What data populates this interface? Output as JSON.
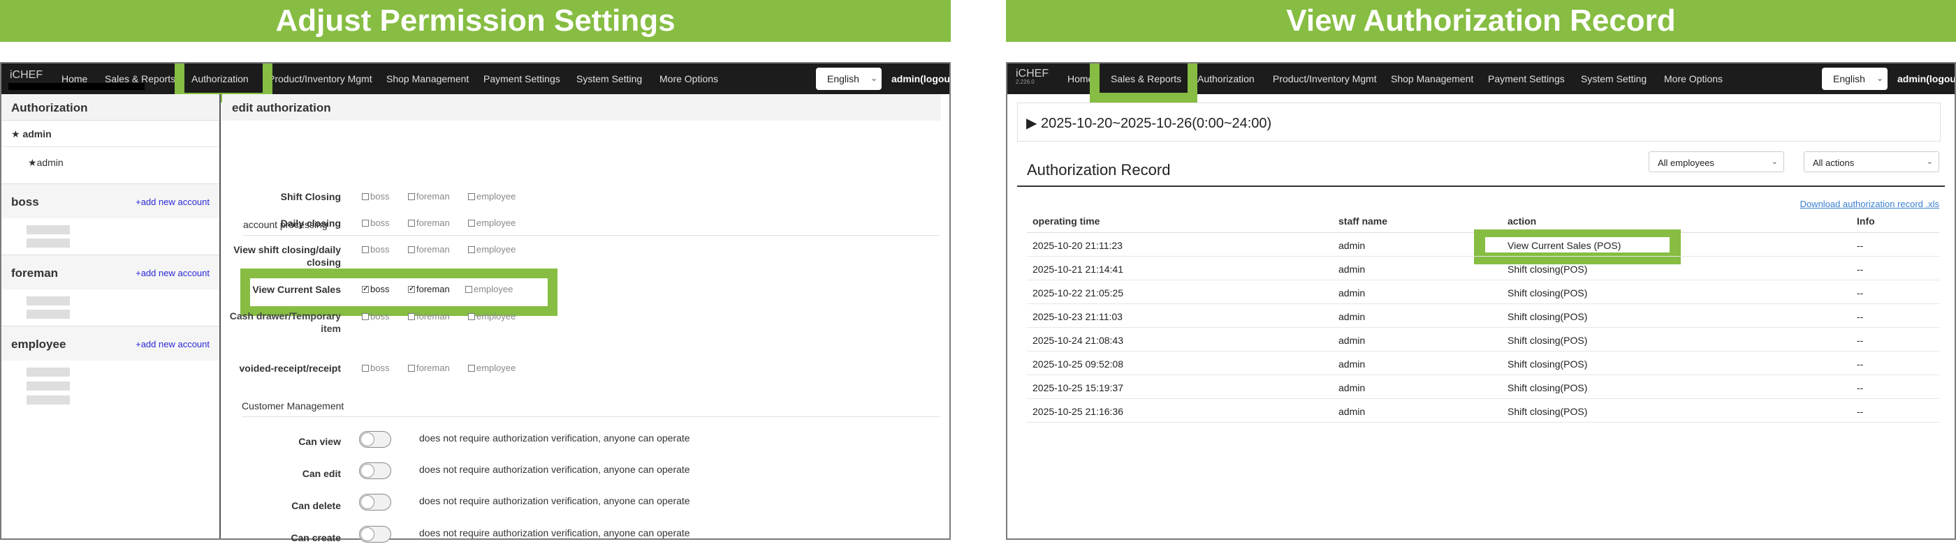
{
  "left": {
    "banner": "Adjust Permission Settings",
    "brand": "iCHEF",
    "nav": [
      "Home",
      "Sales & Reports",
      "Authorization",
      "Product/Inventory Mgmt",
      "Shop Management",
      "Payment Settings",
      "System Setting",
      "More Options"
    ],
    "language": "English",
    "user": "admin(logout)",
    "sidebar": {
      "title": "Authorization",
      "admin_group": "admin",
      "admin_user": "admin",
      "sections": [
        {
          "name": "boss",
          "add": "+add new account"
        },
        {
          "name": "foreman",
          "add": "+add new account"
        },
        {
          "name": "employee",
          "add": "+add new account"
        }
      ]
    },
    "main": {
      "title": "edit authorization",
      "group1": "account processing",
      "roles": [
        "boss",
        "foreman",
        "employee"
      ],
      "perms": [
        {
          "label": "Shift Closing",
          "checked": [
            false,
            false,
            false
          ]
        },
        {
          "label": "Daily closing",
          "checked": [
            false,
            false,
            false
          ]
        },
        {
          "label": "View shift closing/daily closing",
          "checked": [
            false,
            false,
            false
          ]
        },
        {
          "label": "View Current Sales",
          "checked": [
            true,
            true,
            false
          ]
        },
        {
          "label": "Cash drawer/Temporary item",
          "checked": [
            false,
            false,
            false
          ]
        },
        {
          "label": "voided-receipt/receipt",
          "checked": [
            false,
            false,
            false
          ]
        }
      ],
      "group2": "Customer Management",
      "toggles": [
        {
          "label": "Can view",
          "text": "does not require authorization verification, anyone can operate"
        },
        {
          "label": "Can edit",
          "text": "does not require authorization verification, anyone can operate"
        },
        {
          "label": "Can delete",
          "text": "does not require authorization verification, anyone can operate"
        },
        {
          "label": "Can create",
          "text": "does not require authorization verification, anyone can operate"
        }
      ]
    }
  },
  "right": {
    "banner": "View Authorization Record",
    "brand": "iCHEF",
    "version": "2.226.0",
    "nav": [
      "Home",
      "Sales & Reports",
      "Authorization",
      "Product/Inventory Mgmt",
      "Shop Management",
      "Payment Settings",
      "System Setting",
      "More Options"
    ],
    "language": "English",
    "user": "admin(logout)",
    "date_range": "2025-10-20~2025-10-26(0:00~24:00)",
    "record_title": "Authorization Record",
    "filter_employees": "All employees",
    "filter_actions": "All actions",
    "download": "Download authorization record .xls",
    "columns": [
      "operating time",
      "staff name",
      "action",
      "Info"
    ],
    "rows": [
      {
        "time": "2025-10-20 21:11:23",
        "staff": "admin",
        "action": "View Current Sales (POS)",
        "info": "--"
      },
      {
        "time": "2025-10-21 21:14:41",
        "staff": "admin",
        "action": "Shift closing(POS)",
        "info": "--"
      },
      {
        "time": "2025-10-22 21:05:25",
        "staff": "admin",
        "action": "Shift closing(POS)",
        "info": "--"
      },
      {
        "time": "2025-10-23 21:11:03",
        "staff": "admin",
        "action": "Shift closing(POS)",
        "info": "--"
      },
      {
        "time": "2025-10-24 21:08:43",
        "staff": "admin",
        "action": "Shift closing(POS)",
        "info": "--"
      },
      {
        "time": "2025-10-25 09:52:08",
        "staff": "admin",
        "action": "Shift closing(POS)",
        "info": "--"
      },
      {
        "time": "2025-10-25 15:19:37",
        "staff": "admin",
        "action": "Shift closing(POS)",
        "info": "--"
      },
      {
        "time": "2025-10-25 21:16:36",
        "staff": "admin",
        "action": "Shift closing(POS)",
        "info": "--"
      }
    ],
    "colors": {
      "highlight": "#86bd42",
      "nav_bg": "#1c1c1c",
      "link": "#3a7fd0"
    }
  }
}
